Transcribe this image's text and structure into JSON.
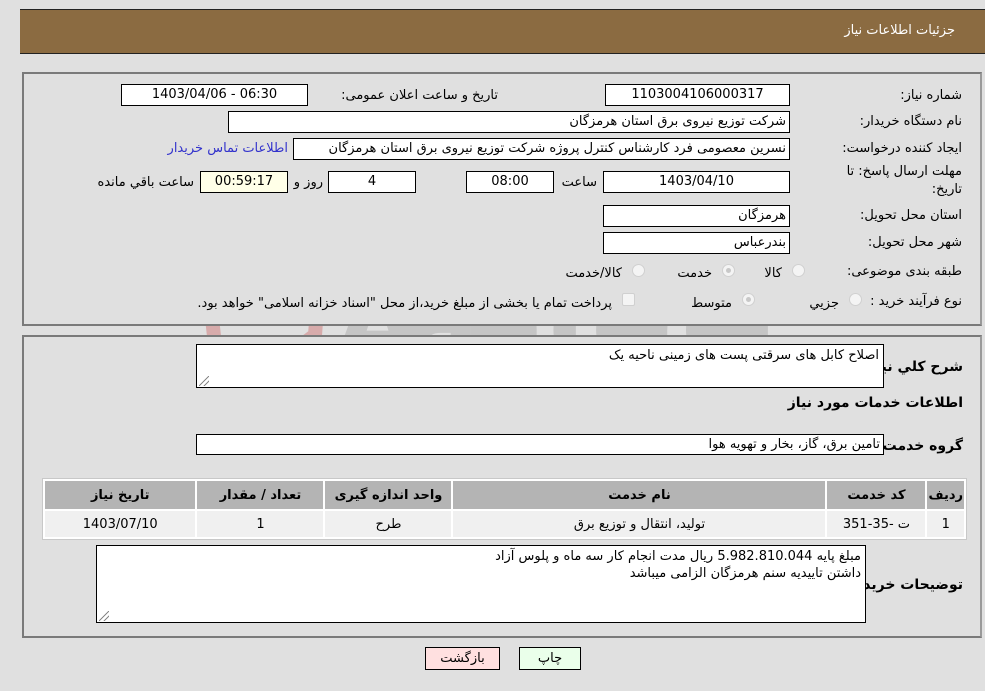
{
  "header": {
    "title": "جزئیات اطلاعات نیاز"
  },
  "details": {
    "need_number_label": "شماره نیاز:",
    "need_number": "1103004106000317",
    "announce_label": "تاریخ و ساعت اعلان عمومی:",
    "announce_value": "1403/04/06 - 06:30",
    "buyer_org_label": "نام دستگاه خریدار:",
    "buyer_org": "شرکت توزیع نیروی برق استان هرمزگان",
    "creator_label": "ایجاد کننده درخواست:",
    "creator": "نسرین معصومی فرد کارشناس کنترل پروژه شرکت توزیع نیروی برق استان هرمزگان",
    "contact_link": "اطلاعات تماس خریدار",
    "deadline_label_line1": "مهلت ارسال پاسخ: تا",
    "deadline_label_line2": "تاریخ:",
    "deadline_date": "1403/04/10",
    "time_label": "ساعت",
    "deadline_time": "08:00",
    "days_value": "4",
    "days_label": "روز و",
    "remaining_time": "00:59:17",
    "remaining_label": "ساعت باقي مانده",
    "province_label": "استان محل تحویل:",
    "province": "هرمزگان",
    "city_label": "شهر محل تحویل:",
    "city": "بندرعباس",
    "category_label": "طبقه بندی موضوعی:",
    "category_options": [
      {
        "label": "کالا",
        "checked": false
      },
      {
        "label": "خدمت",
        "checked": true
      },
      {
        "label": "کالا/خدمت",
        "checked": false
      }
    ],
    "process_label": "نوع فرآیند خرید :",
    "process_options": [
      {
        "label": "جزيي",
        "checked": false
      },
      {
        "label": "متوسط",
        "checked": true
      }
    ],
    "treasury_note": "پرداخت تمام یا بخشی از مبلغ خرید،از محل \"اسناد خزانه اسلامی\" خواهد بود."
  },
  "services": {
    "summary_label": "شرح کلي نياز:",
    "summary": "اصلاح کابل های سرقتی پست های زمینی ناحیه یک",
    "section_title": "اطلاعات خدمات مورد نیاز",
    "group_label": "گروه خدمت:",
    "group_value": "تامین برق، گاز، بخار و تهویه هوا",
    "table": {
      "headers": [
        "ردیف",
        "کد خدمت",
        "نام خدمت",
        "واحد اندازه گیری",
        "تعداد / مقدار",
        "تاریخ نیاز"
      ],
      "rows": [
        [
          "1",
          "ت -35-351",
          "تولید، انتقال و توزیع برق",
          "طرح",
          "1",
          "1403/07/10"
        ]
      ]
    },
    "buyer_notes_label": "توضیحات خریدار:",
    "buyer_notes_line1": "مبلغ پایه 5.982.810.044 ریال مدت انجام کار سه ماه و پلوس آزاد",
    "buyer_notes_line2": "داشتن تاییدیه سنم هرمزگان الزامی میباشد"
  },
  "buttons": {
    "print": "چاپ",
    "back": "بازگشت"
  },
  "watermark": {
    "text": "AriaTender.neT"
  }
}
